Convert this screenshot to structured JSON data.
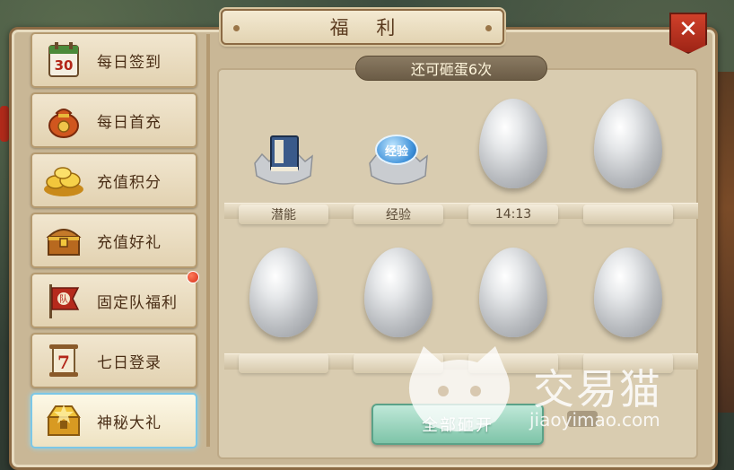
{
  "window": {
    "title": "福 利",
    "close_icon": "close-icon"
  },
  "sidebar": {
    "items": [
      {
        "label": "每日签到",
        "icon": "calendar-30-icon",
        "active": false,
        "badge": false
      },
      {
        "label": "每日首充",
        "icon": "money-bag-icon",
        "active": false,
        "badge": false
      },
      {
        "label": "充值积分",
        "icon": "gold-ingots-icon",
        "active": false,
        "badge": false
      },
      {
        "label": "充值好礼",
        "icon": "treasure-chest-icon",
        "active": false,
        "badge": false
      },
      {
        "label": "固定队福利",
        "icon": "team-flag-icon",
        "active": false,
        "badge": true
      },
      {
        "label": "七日登录",
        "icon": "scroll-7-icon",
        "active": false,
        "badge": false
      },
      {
        "label": "神秘大礼",
        "icon": "golden-chest-icon",
        "active": true,
        "badge": false
      }
    ]
  },
  "main": {
    "remaining_text": "还可砸蛋6次",
    "row1": [
      {
        "state": "opened",
        "reward_icon": "skill-book-icon",
        "label": "潜能"
      },
      {
        "state": "opened",
        "reward_icon": "exp-orb-icon",
        "label": "经验",
        "icon_text": "经验"
      },
      {
        "state": "egg",
        "label": "14:13"
      },
      {
        "state": "egg",
        "label": ""
      }
    ],
    "row2": [
      {
        "state": "egg",
        "label": ""
      },
      {
        "state": "egg",
        "label": ""
      },
      {
        "state": "egg",
        "label": ""
      },
      {
        "state": "egg",
        "label": ""
      }
    ],
    "smash_all_label": "全部砸开"
  },
  "watermark": {
    "name": "交易猫",
    "url": "jiaoyimao.com"
  },
  "colors": {
    "panel_bg": "#c9b796",
    "active_border": "#7cc7e6",
    "close_red": "#c0341f",
    "smash_button": "#7ec4a8"
  }
}
